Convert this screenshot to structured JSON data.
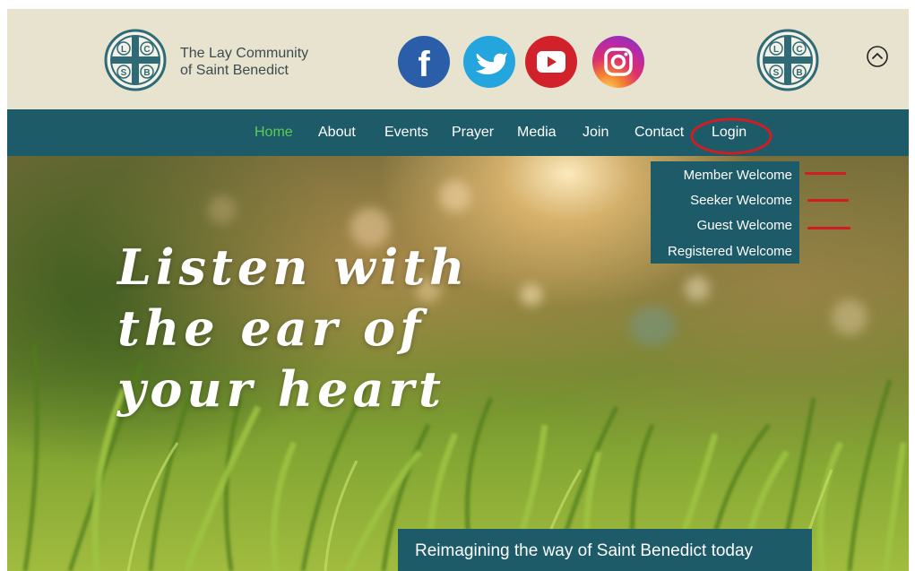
{
  "brand": {
    "line1": "The Lay Community",
    "line2": "of Saint Benedict"
  },
  "logo": {
    "letters": [
      "L",
      "C",
      "S",
      "B"
    ]
  },
  "social": [
    {
      "name": "facebook-icon",
      "glyph": "f",
      "color": "#2b5ea8"
    },
    {
      "name": "twitter-icon",
      "color": "#25a5dd"
    },
    {
      "name": "youtube-icon",
      "color": "#d1212a"
    },
    {
      "name": "instagram-icon"
    }
  ],
  "nav": {
    "items": [
      {
        "label": "Home",
        "active": true
      },
      {
        "label": "About"
      },
      {
        "label": "Events"
      },
      {
        "label": "Prayer"
      },
      {
        "label": "Media"
      },
      {
        "label": "Join"
      },
      {
        "label": "Contact"
      },
      {
        "label": "Login"
      }
    ]
  },
  "login_menu": {
    "items": [
      "Member Welcome",
      "Seeker Welcome",
      "Guest Welcome",
      "Registered Welcome"
    ]
  },
  "hero": {
    "headline": [
      "Listen with",
      "the ear of",
      "your heart"
    ],
    "caption": "Reimagining the way of Saint Benedict today"
  },
  "colors": {
    "header_bg": "#e8e3cf",
    "nav_bg": "#1d5b69",
    "active_nav": "#5bcc54",
    "annotation": "#d11c24"
  }
}
